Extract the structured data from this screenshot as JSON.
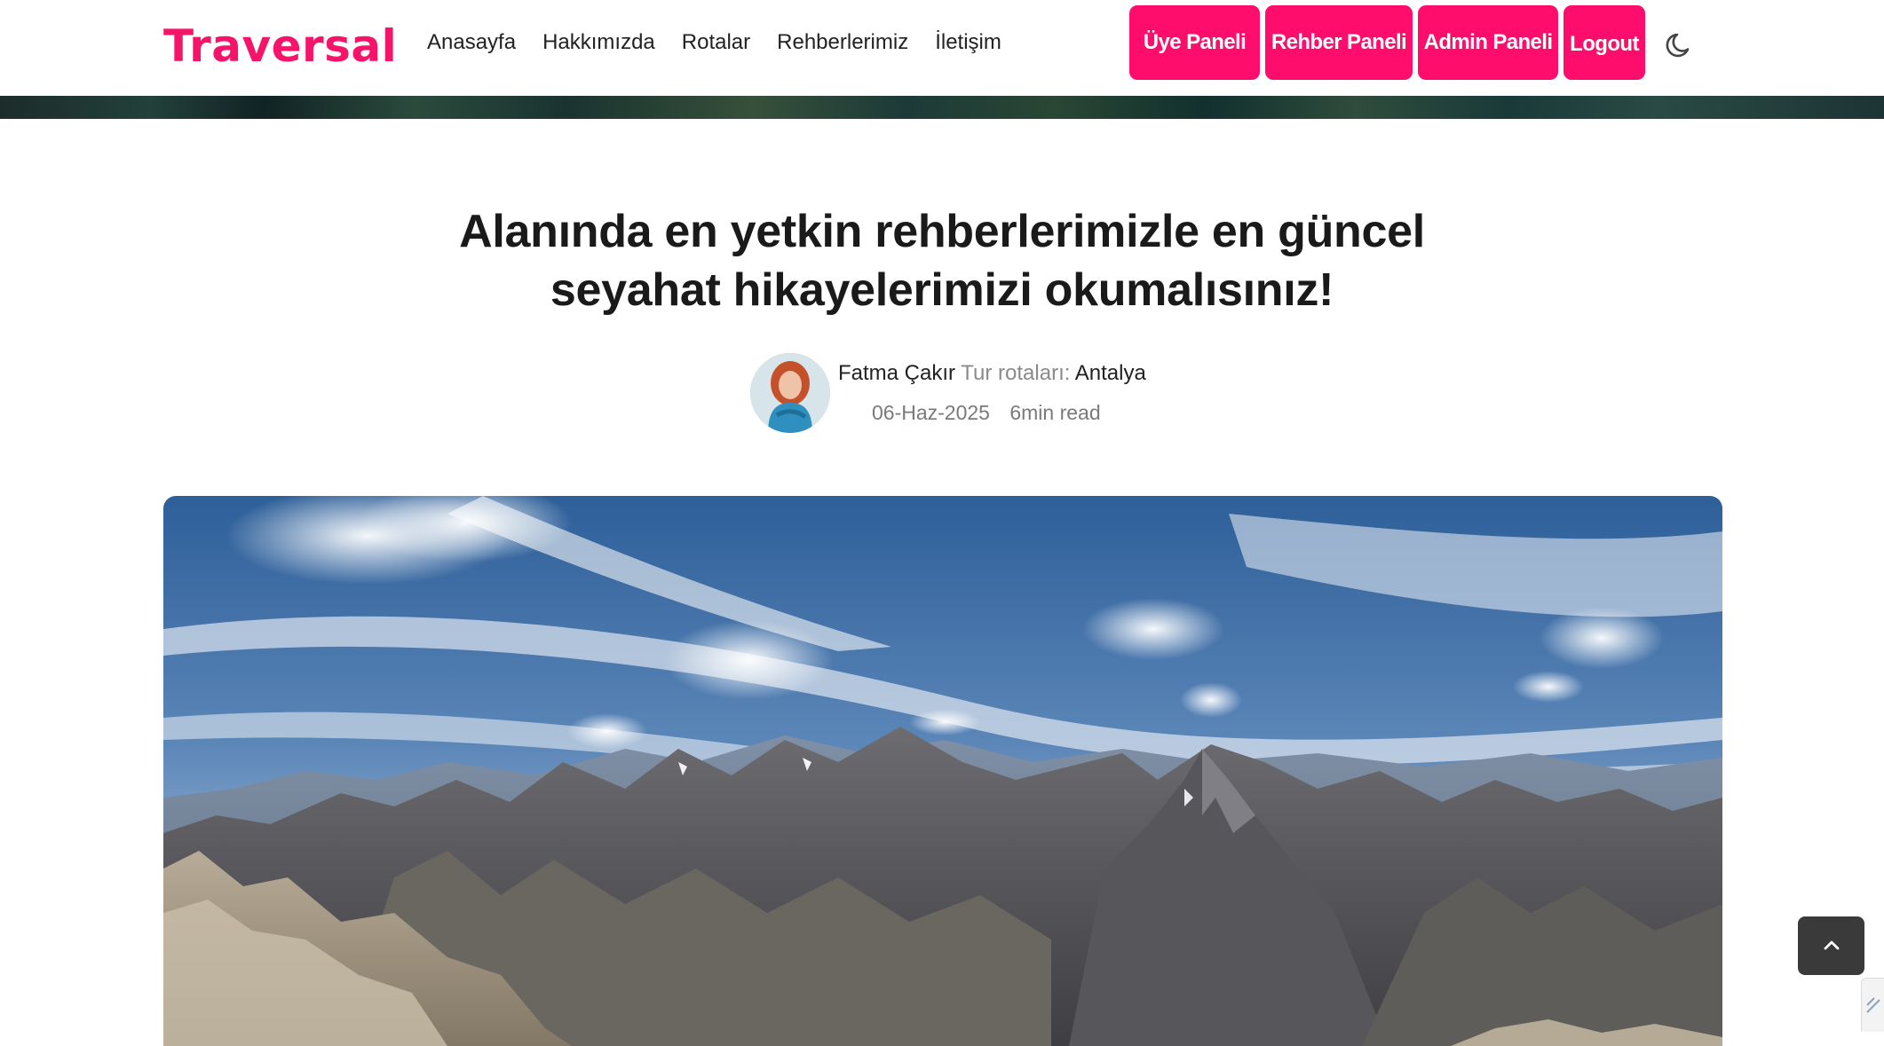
{
  "header": {
    "logo": "Traversal",
    "nav": [
      "Anasayfa",
      "Hakkımızda",
      "Rotalar",
      "Rehberlerimiz",
      "İletişim"
    ],
    "buttons": {
      "uye": "Üye Paneli",
      "rehber": "Rehber Paneli",
      "admin": "Admin Paneli",
      "logout": "Logout"
    },
    "theme_icon": "moon-icon"
  },
  "article": {
    "title": "Alanında en yetkin rehberlerimizle en güncel seyahat hikayelerimizi okumalısınız!",
    "author": "Fatma Çakır",
    "route_label": "Tur rotaları:",
    "route_value": "Antalya",
    "date": "06-Haz-2025",
    "read_time": "6min read"
  },
  "colors": {
    "brand": "#f5146a",
    "button": "#ff0d6d",
    "scroll_button": "#3a3a3a"
  },
  "icons": {
    "scroll_top": "chevron-up-icon"
  }
}
